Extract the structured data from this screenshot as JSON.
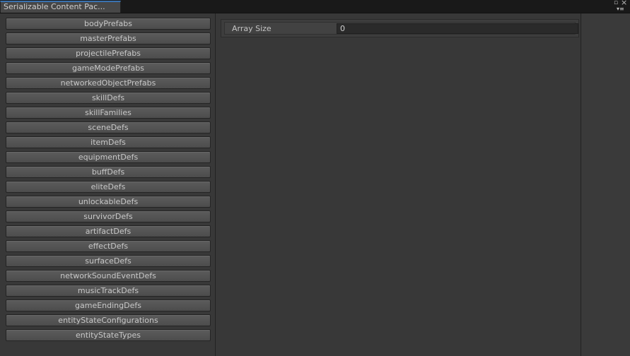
{
  "window": {
    "tab_title": "Serializable Content Pac...",
    "icons": {
      "maximize": "maximize-icon",
      "close": "close-icon",
      "menu": "menu-icon"
    }
  },
  "left_panel": {
    "buttons": [
      "bodyPrefabs",
      "masterPrefabs",
      "projectilePrefabs",
      "gameModePrefabs",
      "networkedObjectPrefabs",
      "skillDefs",
      "skillFamilies",
      "sceneDefs",
      "itemDefs",
      "equipmentDefs",
      "buffDefs",
      "eliteDefs",
      "unlockableDefs",
      "survivorDefs",
      "artifactDefs",
      "effectDefs",
      "surfaceDefs",
      "networkSoundEventDefs",
      "musicTrackDefs",
      "gameEndingDefs",
      "entityStateConfigurations",
      "entityStateTypes"
    ]
  },
  "inspector": {
    "array_size_label": "Array Size",
    "array_size_value": "0"
  },
  "colors": {
    "background": "#383838",
    "tab_accent": "#3a72b0",
    "button": "#555555",
    "text": "#c4c4c4"
  }
}
